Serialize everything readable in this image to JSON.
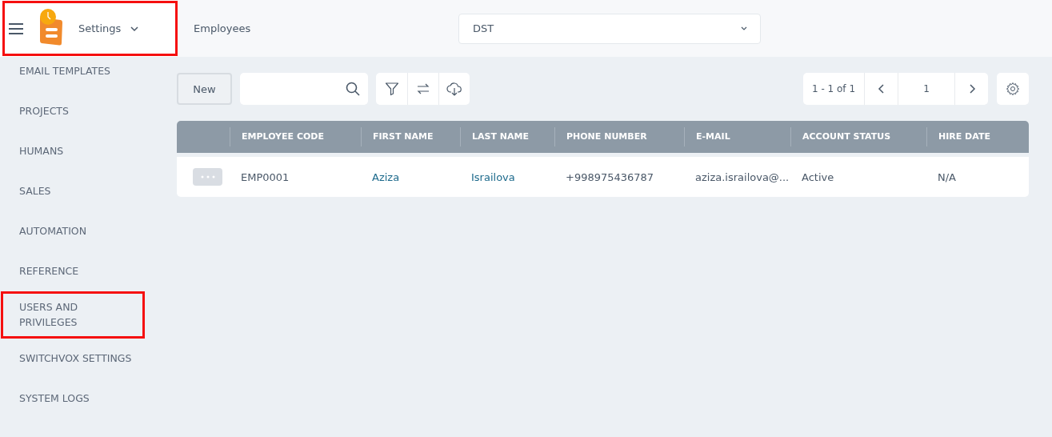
{
  "header": {
    "module": "Settings",
    "highlighted": true,
    "page_title": "Employees",
    "company_select": {
      "value": "DST"
    }
  },
  "sidebar": {
    "items": [
      {
        "label": "EMAIL TEMPLATES",
        "highlighted": false
      },
      {
        "label": "PROJECTS",
        "highlighted": false
      },
      {
        "label": "HUMANS",
        "highlighted": false
      },
      {
        "label": "SALES",
        "highlighted": false
      },
      {
        "label": "AUTOMATION",
        "highlighted": false
      },
      {
        "label": "REFERENCE",
        "highlighted": false
      },
      {
        "label": "USERS AND PRIVILEGES",
        "highlighted": true
      },
      {
        "label": "SWITCHVOX SETTINGS",
        "highlighted": false
      },
      {
        "label": "SYSTEM LOGS",
        "highlighted": false
      }
    ]
  },
  "toolbar": {
    "new_button": "New",
    "pagination": {
      "range": "1 - 1 of 1",
      "page": "1"
    }
  },
  "table": {
    "columns": [
      "",
      "EMPLOYEE CODE",
      "FIRST NAME",
      "LAST NAME",
      "PHONE NUMBER",
      "E-MAIL",
      "ACCOUNT STATUS",
      "HIRE DATE"
    ],
    "rows": [
      {
        "cells": [
          {
            "kind": "actions"
          },
          {
            "kind": "text",
            "text": "EMP0001"
          },
          {
            "kind": "link",
            "text": "Aziza"
          },
          {
            "kind": "link",
            "text": "Israilova"
          },
          {
            "kind": "text",
            "text": "+998975436787"
          },
          {
            "kind": "text",
            "text": "aziza.israilova@..."
          },
          {
            "kind": "text",
            "text": "Active"
          },
          {
            "kind": "text",
            "text": "N/A"
          }
        ]
      }
    ]
  }
}
